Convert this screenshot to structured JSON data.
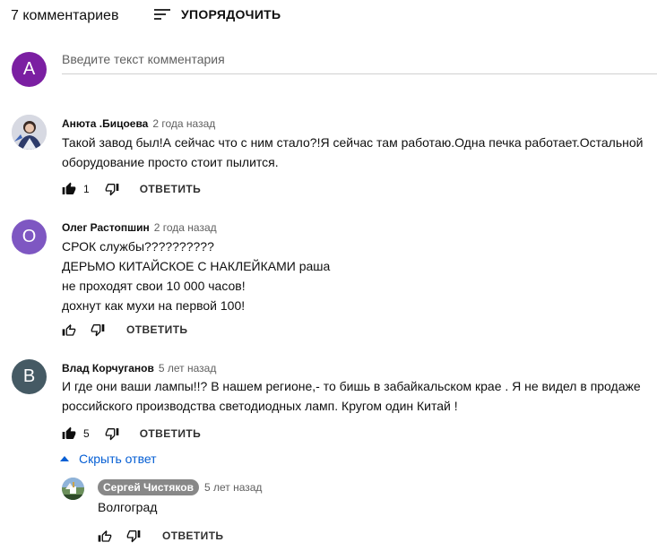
{
  "header": {
    "comments_count": "7 комментариев",
    "sort_label": "УПОРЯДОЧИТЬ"
  },
  "new_comment": {
    "avatar_letter": "A",
    "avatar_color": "#7b1fa2",
    "placeholder": "Введите текст комментария"
  },
  "comments": [
    {
      "author": "Анюта .Бицоева",
      "time": "2 года назад",
      "lines": [
        "Такой завод был!А сейчас что с ним стало?!Я сейчас там работаю.Одна печка работает.Остальной",
        "оборудование просто стоит пылится."
      ],
      "likes": "1",
      "liked": true,
      "reply_label": "ОТВЕТИТЬ",
      "avatar_type": "photo"
    },
    {
      "author": "Олег Растопшин",
      "time": "2 года назад",
      "lines": [
        "СРОК службы??????????",
        "ДЕРЬМО КИТАЙСКОЕ С НАКЛЕЙКАМИ раша",
        "не проходят свои 10 000 часов!",
        "дохнут как мухи на первой 100!"
      ],
      "likes": "",
      "liked": false,
      "reply_label": "ОТВЕТИТЬ",
      "avatar_letter": "О",
      "avatar_color": "#7e57c2"
    },
    {
      "author": "Влад Корчуганов",
      "time": "5 лет назад",
      "lines": [
        "И где они  ваши лампы!!? В нашем регионе,- то бишь в забайкальском крае . Я не видел в продаже",
        "российского производства светодиодных  ламп. Кругом один Китай !"
      ],
      "likes": "5",
      "liked": true,
      "reply_label": "ОТВЕТИТЬ",
      "avatar_letter": "B",
      "avatar_color": "#455a64"
    }
  ],
  "show_reply_label": "Скрыть ответ",
  "reply": {
    "author": "Сергей Чистяков",
    "time": "5 лет назад",
    "text": "Волгоград",
    "reply_label": "ОТВЕТИТЬ",
    "avatar_type": "photo"
  },
  "colors": {
    "link": "#065fd4",
    "secondary_text": "#606060",
    "owner_chip": "#888888"
  }
}
